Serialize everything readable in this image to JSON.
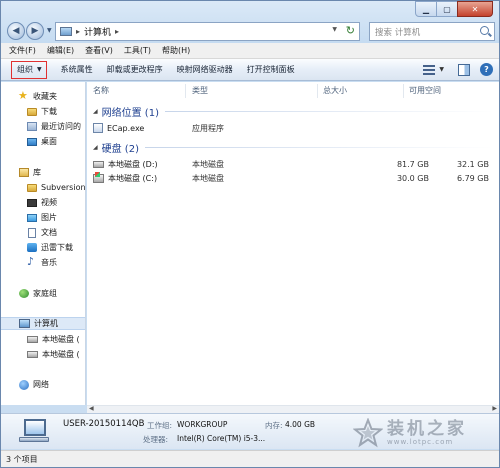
{
  "address": {
    "crumb": "计算机",
    "search_placeholder": "搜索 计算机"
  },
  "menu": [
    "文件(F)",
    "编辑(E)",
    "查看(V)",
    "工具(T)",
    "帮助(H)"
  ],
  "toolbar": {
    "organize": "组织",
    "system_properties": "系统属性",
    "uninstall": "卸载或更改程序",
    "map_drive": "映射网络驱动器",
    "control_panel": "打开控制面板"
  },
  "columns": {
    "name": "名称",
    "type": "类型",
    "total": "总大小",
    "free": "可用空间"
  },
  "nav": {
    "favorites": "收藏夹",
    "downloads": "下载",
    "recent": "最近访问的",
    "desktop": "桌面",
    "libraries": "库",
    "subversion": "Subversion",
    "videos": "视频",
    "pictures": "图片",
    "documents": "文档",
    "thunder": "迅雷下载",
    "music": "音乐",
    "homegroup": "家庭组",
    "computer": "计算机",
    "drive_d": "本地磁盘 (",
    "drive_c": "本地磁盘 (",
    "network": "网络"
  },
  "groups": {
    "network": "网络位置 (1)",
    "hdd": "硬盘 (2)"
  },
  "rows": {
    "ecap": {
      "name": "ECap.exe",
      "type": "应用程序"
    },
    "d": {
      "name": "本地磁盘 (D:)",
      "type": "本地磁盘",
      "total": "81.7 GB",
      "free": "32.1 GB"
    },
    "c": {
      "name": "本地磁盘 (C:)",
      "type": "本地磁盘",
      "total": "30.0 GB",
      "free": "6.79 GB"
    }
  },
  "details": {
    "pc_name": "USER-20150114QB",
    "workgroup_label": "工作组:",
    "workgroup": "WORKGROUP",
    "memory_label": "内存:",
    "memory": "4.00 GB",
    "cpu_label": "处理器:",
    "cpu": "Intel(R) Core(TM) i5-3..."
  },
  "status": "3 个项目",
  "watermark": {
    "cn": "装机之家",
    "url": "www.lotpc.com"
  }
}
